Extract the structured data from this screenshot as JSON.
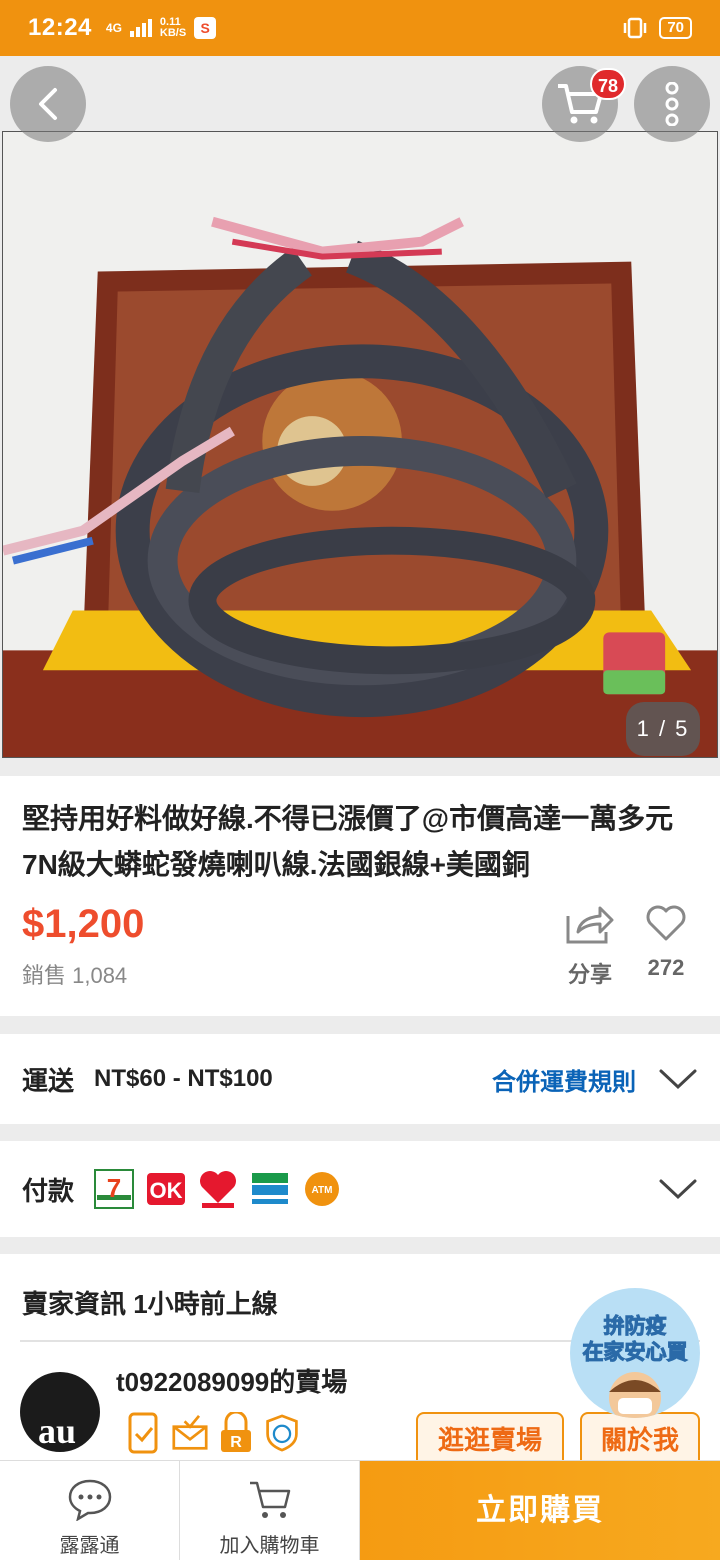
{
  "status_bar": {
    "time": "12:24",
    "network": "4G",
    "speed": "0.11",
    "speed_unit": "KB/S",
    "battery": "70"
  },
  "gallery": {
    "cart_count": "78",
    "page_indicator": "1 / 5"
  },
  "product": {
    "title": "堅持用好料做好線.不得已漲價了@市價高達一萬多元7N級大蟒蛇發燒喇叭線.法國銀線+美國銅",
    "price": "$1,200",
    "sold": "銷售 1,084",
    "share_label": "分享",
    "likes": "272"
  },
  "shipping": {
    "label": "運送",
    "value": "NT$60 - NT$100",
    "rule_link": "合併運費規則"
  },
  "payment": {
    "label": "付款",
    "methods": [
      "7-ELEVEN",
      "OK",
      "Hi-Life 萊爾富",
      "FamilyMart",
      "ATM"
    ]
  },
  "seller": {
    "heading": "賣家資訊  1小時前上線",
    "name": "t0922089099的賣場",
    "browse_label": "逛逛賣場",
    "about_label": "關於我",
    "promo_line1": "拚防疫",
    "promo_line2": "在家安心買"
  },
  "bottom_bar": {
    "chat_label": "露露通",
    "add_cart_label": "加入購物車",
    "buy_now_label": "立即購買"
  },
  "colors": {
    "accent": "#f0920f",
    "price": "#ee4d2d",
    "link": "#0a63b7"
  }
}
